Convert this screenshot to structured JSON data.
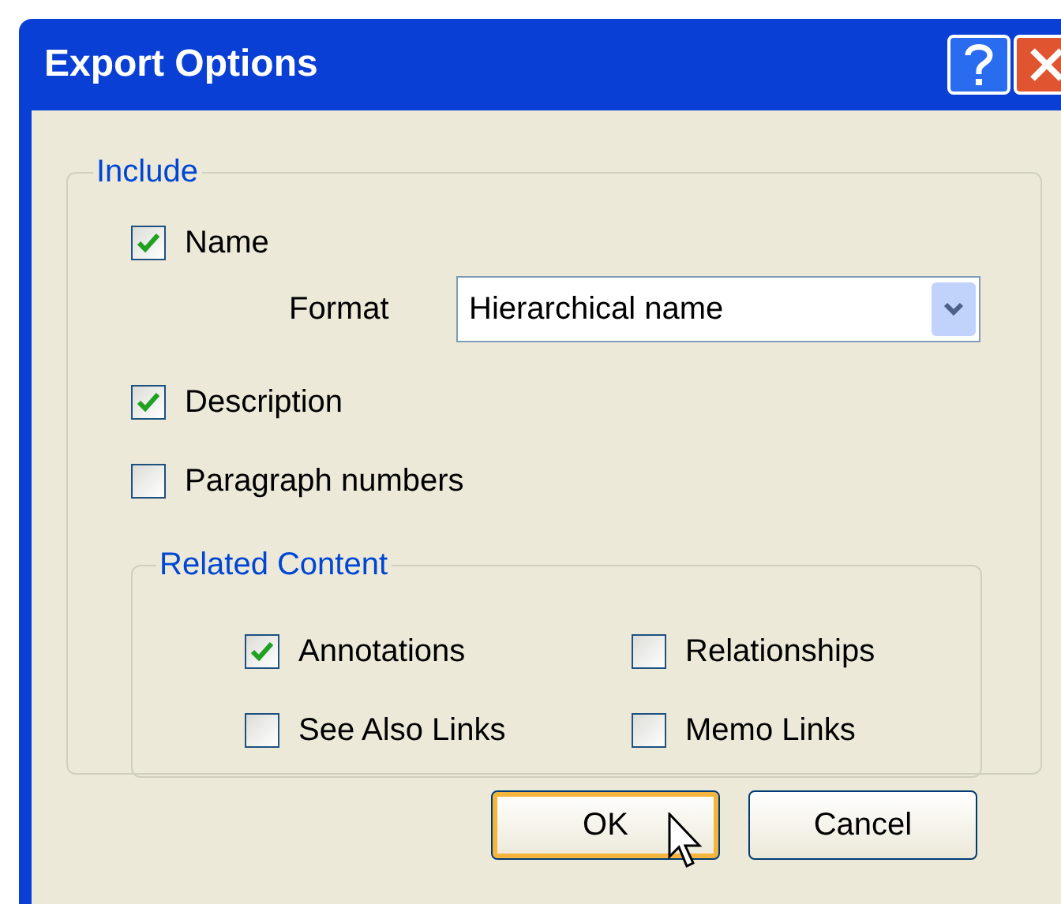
{
  "window": {
    "title": "Export Options"
  },
  "include": {
    "legend": "Include",
    "options": [
      {
        "kind": "checkbox",
        "label": "Name",
        "checked": true
      },
      {
        "kind": "dropdown",
        "label": "Format",
        "value": "Hierarchical name"
      },
      {
        "kind": "checkbox",
        "label": "Description",
        "checked": true
      },
      {
        "kind": "checkbox",
        "label": "Paragraph numbers",
        "checked": false
      }
    ],
    "related_content": {
      "legend": "Related Content",
      "options": [
        {
          "label": "Annotations",
          "checked": true
        },
        {
          "label": "Relationships",
          "checked": false
        },
        {
          "label": "See Also Links",
          "checked": false
        },
        {
          "label": "Memo Links",
          "checked": false
        }
      ]
    }
  },
  "buttons": [
    {
      "label": "OK",
      "focused": true
    },
    {
      "label": "Cancel",
      "focused": false
    }
  ]
}
